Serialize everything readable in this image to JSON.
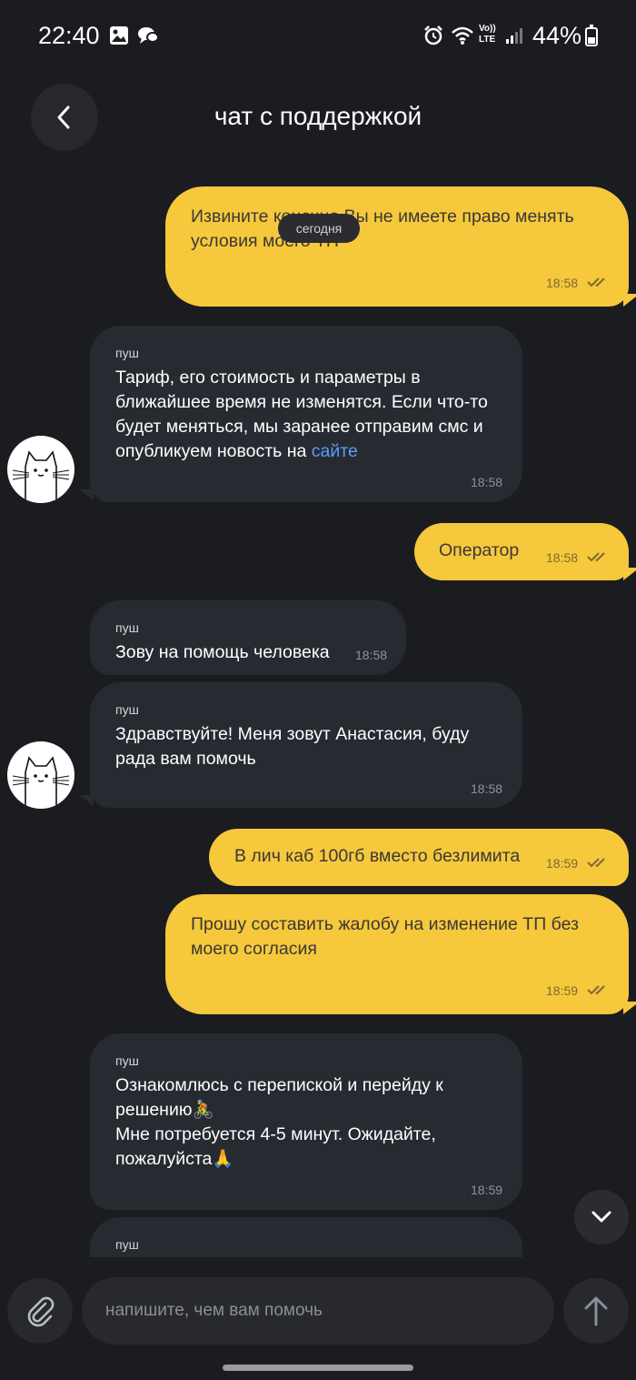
{
  "status_bar": {
    "time": "22:40",
    "battery_pct": "44%",
    "battery_level": 0.44,
    "network": "LTE",
    "network_top": "Vo))"
  },
  "header": {
    "title": "чат с поддержкой",
    "back_icon": "chevron-left-icon"
  },
  "chat": {
    "date_label": "сегодня",
    "messages": [
      {
        "dir": "out",
        "text": "Извините конечно Вы не имеете право менять условия моего ТП",
        "time": "18:58",
        "status": "read"
      },
      {
        "dir": "in",
        "sender": "пуш",
        "text": "Тариф, его стоимость и параметры в ближайшее время не изменятся. Если что-то будет меняться, мы заранее отправим смс и опубликуем новость на",
        "link": "сайте",
        "time": "18:58"
      },
      {
        "dir": "out",
        "text": "Оператор",
        "time": "18:58",
        "status": "read"
      },
      {
        "dir": "in",
        "sender": "пуш",
        "text": "Зову на помощь человека",
        "time": "18:58"
      },
      {
        "dir": "in",
        "sender": "пуш",
        "text": "Здравствуйте! Меня зовут Анастасия, буду рада вам помочь",
        "time": "18:58"
      },
      {
        "dir": "out",
        "text": "В лич каб 100гб вместо безлимита",
        "time": "18:59",
        "status": "read"
      },
      {
        "dir": "out",
        "text": "Прошу составить жалобу на изменение ТП без моего согласия",
        "time": "18:59",
        "status": "read"
      },
      {
        "dir": "in",
        "sender": "пуш",
        "text": "Ознакомлюсь  с перепиской и перейду к решению🚴\nМне потребуется 4-5 минут. Ожидайте, пожалуйста🙏",
        "time": "18:59"
      },
      {
        "dir": "in",
        "sender": "пуш",
        "text": "",
        "time": ""
      }
    ]
  },
  "composer": {
    "placeholder": "напишите, чем вам помочь",
    "attach_icon": "paperclip-icon",
    "send_icon": "arrow-up-icon"
  },
  "colors": {
    "background": "#1b1c20",
    "outgoing": "#f6c83c",
    "incoming": "#282a31",
    "link": "#5b9df5"
  }
}
